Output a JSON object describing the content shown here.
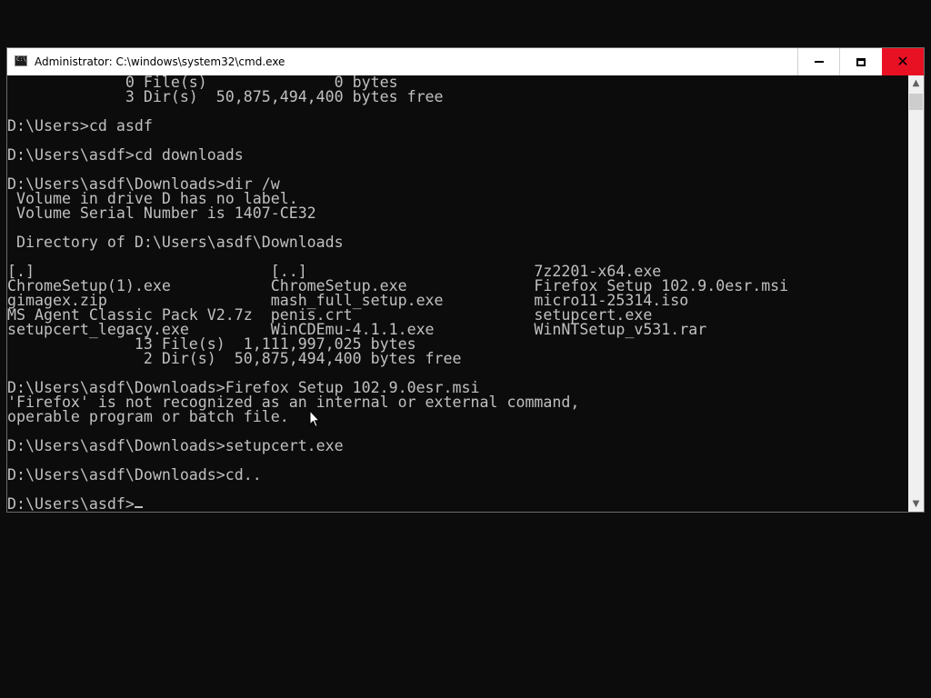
{
  "window": {
    "title": "Administrator: C:\\windows\\system32\\cmd.exe",
    "icon": "cmd-icon",
    "controls": {
      "minimize": "minimize-icon",
      "maximize": "maximize-icon",
      "close": "✕"
    }
  },
  "console": {
    "lines": [
      "             0 File(s)              0 bytes",
      "             3 Dir(s)  50,875,494,400 bytes free",
      "",
      "D:\\Users>cd asdf",
      "",
      "D:\\Users\\asdf>cd downloads",
      "",
      "D:\\Users\\asdf\\Downloads>dir /w",
      " Volume in drive D has no label.",
      " Volume Serial Number is 1407-CE32",
      "",
      " Directory of D:\\Users\\asdf\\Downloads",
      "",
      "[.]                          [..]                         7z2201-x64.exe",
      "ChromeSetup(1).exe           ChromeSetup.exe              Firefox Setup 102.9.0esr.msi",
      "gimagex.zip                  mash_full_setup.exe          micro11-25314.iso",
      "MS Agent Classic Pack V2.7z  penis.crt                    setupcert.exe",
      "setupcert_legacy.exe         WinCDEmu-4.1.1.exe           WinNTSetup_v531.rar",
      "              13 File(s)  1,111,997,025 bytes",
      "               2 Dir(s)  50,875,494,400 bytes free",
      "",
      "D:\\Users\\asdf\\Downloads>Firefox Setup 102.9.0esr.msi",
      "'Firefox' is not recognized as an internal or external command,",
      "operable program or batch file.",
      "",
      "D:\\Users\\asdf\\Downloads>setupcert.exe",
      "",
      "D:\\Users\\asdf\\Downloads>cd..",
      ""
    ],
    "prompt": "D:\\Users\\asdf>"
  },
  "scrollbar": {
    "up": "▲",
    "down": "▼"
  },
  "colors": {
    "background": "#0c0c0c",
    "text": "#c0c0c0",
    "close_hover": "#e81123"
  }
}
